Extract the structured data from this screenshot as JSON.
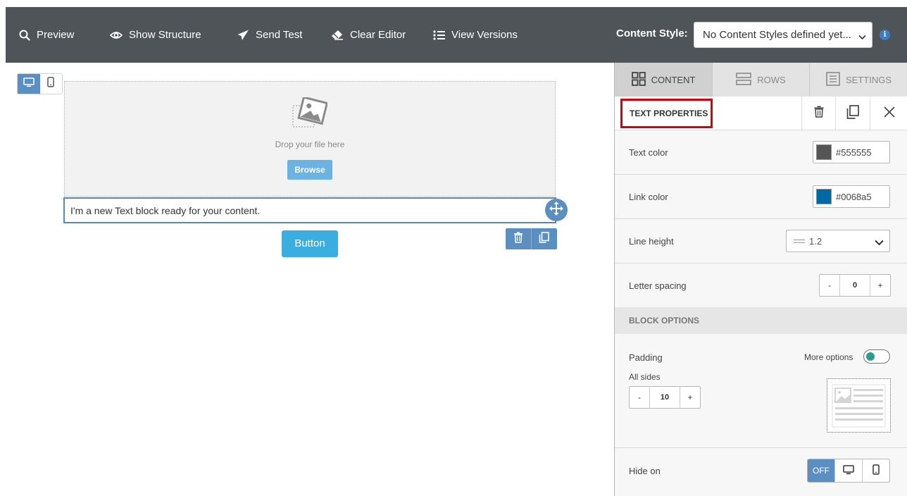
{
  "toolbar": {
    "preview": "Preview",
    "show_structure": "Show Structure",
    "send_test": "Send Test",
    "clear_editor": "Clear Editor",
    "view_versions": "View Versions",
    "content_style_label": "Content Style:",
    "content_style_value": "No Content Styles defined yet..."
  },
  "canvas": {
    "drop_text": "Drop your file here",
    "browse_label": "Browse",
    "text_block": "I'm a new Text block ready for your content.",
    "button_label": "Button"
  },
  "panel": {
    "tabs": [
      "CONTENT",
      "ROWS",
      "SETTINGS"
    ],
    "title": "TEXT PROPERTIES",
    "text_color_label": "Text color",
    "text_color_value": "#555555",
    "link_color_label": "Link color",
    "link_color_value": "#0068a5",
    "line_height_label": "Line height",
    "line_height_value": "1.2",
    "letter_spacing_label": "Letter spacing",
    "letter_spacing_value": "0",
    "block_options": "BLOCK OPTIONS",
    "padding_label": "Padding",
    "more_options_label": "More options",
    "more_options_on": true,
    "all_sides_label": "All sides",
    "padding_value": "10",
    "hide_on_label": "Hide on",
    "hide_off_label": "OFF",
    "stepper_minus": "-",
    "stepper_plus": "+"
  },
  "colors": {
    "toolbar_bg": "#4f5458",
    "accent": "#5b8fc2",
    "button": "#3aaee0",
    "highlight": "#d3000d",
    "text_color_swatch": "#555555",
    "link_color_swatch": "#0068a5"
  }
}
